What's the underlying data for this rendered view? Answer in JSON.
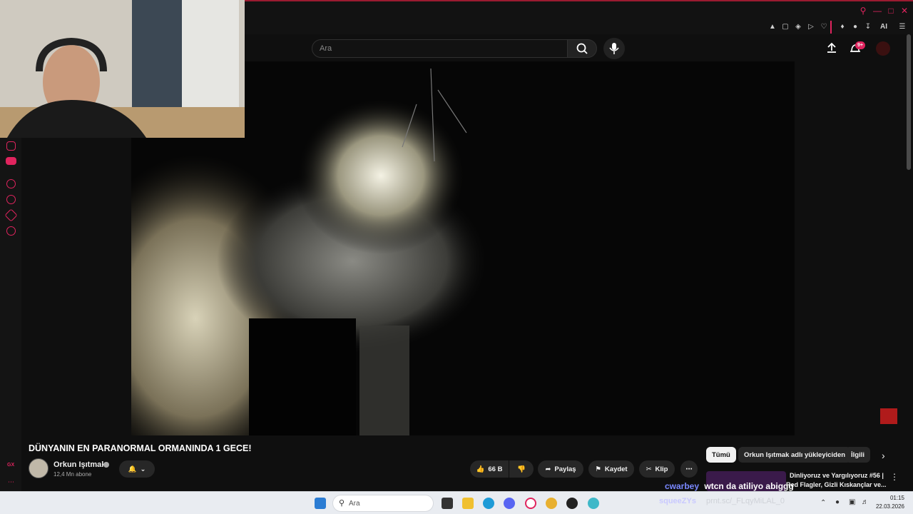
{
  "youtube": {
    "search_placeholder": "Ara",
    "notification_count": "9+"
  },
  "video": {
    "title": "DÜNYANIN EN PARANORMAL ORMANINDA 1 GECE!",
    "channel_name": "Orkun Işıtmak",
    "channel_subs": "12,4 Mn abone",
    "like_count": "66 B",
    "share_label": "Paylaş",
    "save_label": "Kaydet",
    "clip_label": "Klip"
  },
  "chips": [
    "Tümü",
    "Orkun Işıtmak adlı yükleyiciden",
    "İlgili"
  ],
  "related": {
    "title_line1": "Dinliyoruz ve Yargılıyoruz #56 |",
    "title_line2": "Red Flagler, Gizli Kıskançlar ve..."
  },
  "chat_overlay": {
    "user": "cwarbey",
    "message": "wtcn da atiliyo abiggg",
    "faint_user": "squeeZYs",
    "faint_msg": "prnt.sc/_FLqyMiLAL_0"
  },
  "taskbar": {
    "search_placeholder": "Ara",
    "time": "01:15",
    "date": "22.03.2026"
  },
  "colors": {
    "accent": "#e0245e",
    "dark_bg": "#0f0f0f"
  }
}
